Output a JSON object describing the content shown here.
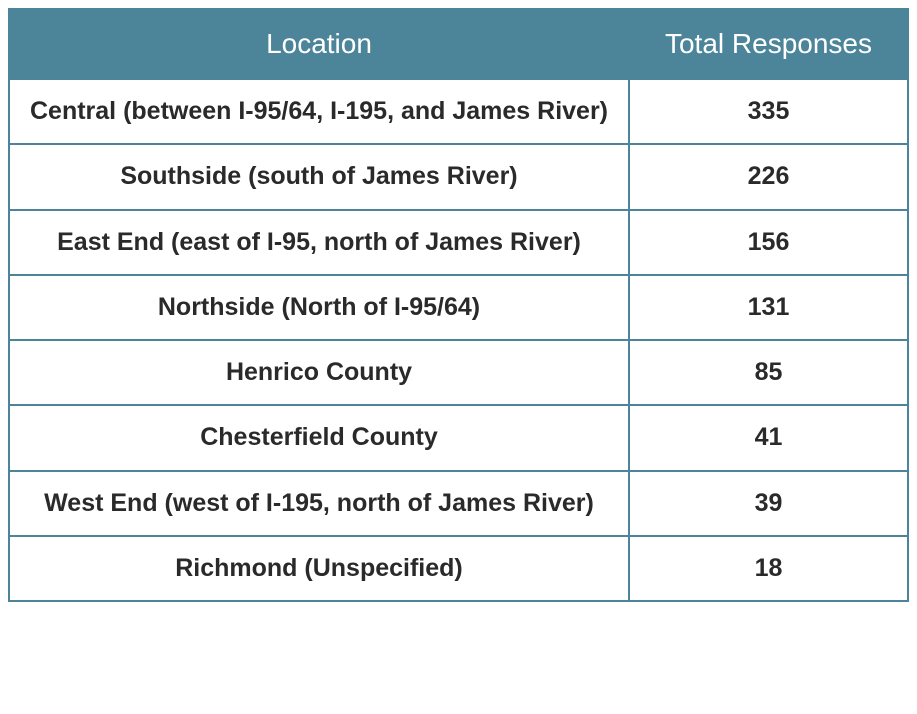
{
  "table": {
    "headers": {
      "location": "Location",
      "responses": "Total Responses"
    },
    "rows": [
      {
        "location": "Central (between I-95/64, I-195, and James River)",
        "responses": "335"
      },
      {
        "location": "Southside (south of James River)",
        "responses": "226"
      },
      {
        "location": "East End (east of I-95, north of James River)",
        "responses": "156"
      },
      {
        "location": "Northside (North of I-95/64)",
        "responses": "131"
      },
      {
        "location": "Henrico County",
        "responses": "85"
      },
      {
        "location": "Chesterfield County",
        "responses": "41"
      },
      {
        "location": "West End (west of I-195, north of James River)",
        "responses": "39"
      },
      {
        "location": "Richmond (Unspecified)",
        "responses": "18"
      }
    ]
  }
}
